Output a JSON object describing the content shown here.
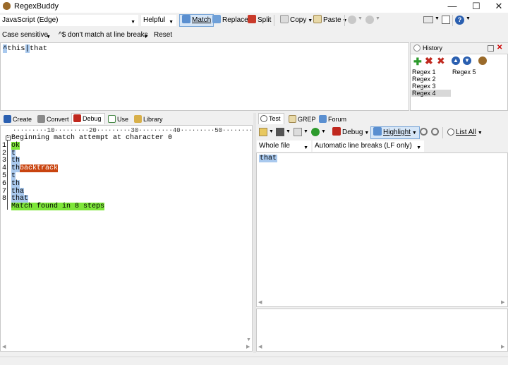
{
  "app": {
    "title": "RegexBuddy",
    "icon": "regexbuddy-icon"
  },
  "window_controls": {
    "minimize": "—",
    "maximize": "☐",
    "close": "✕"
  },
  "toolbar1": {
    "flavor": "JavaScript (Edge)",
    "helpful": "Helpful",
    "match": "Match",
    "replace": "Replace",
    "split": "Split",
    "copy": "Copy",
    "paste": "Paste"
  },
  "toolbar2": {
    "case": "Case sensitive",
    "caret": "^$ don't match at line breaks",
    "reset": "Reset"
  },
  "regex": {
    "caret": "^",
    "part1": "this",
    "pipe": "|",
    "part2": "that"
  },
  "history": {
    "title": "History",
    "items": [
      "Regex 1",
      "Regex 2",
      "Regex 3",
      "Regex 4",
      "Regex 5"
    ],
    "selected": "Regex 4"
  },
  "left_tabs": [
    "Create",
    "Convert",
    "Debug",
    "Use",
    "Library"
  ],
  "right_tabs": [
    "Test",
    "GREP",
    "Forum"
  ],
  "debug": {
    "ruler": "·········10·········20·········30·········40·········50········",
    "lines": [
      {
        "num": "",
        "pre": "",
        "text": "Beginning match attempt at character 0",
        "cls": ""
      },
      {
        "num": "1",
        "pre": "",
        "text": "ok",
        "cls": "g"
      },
      {
        "num": "2",
        "pre": "",
        "text": "t",
        "cls": "b"
      },
      {
        "num": "3",
        "pre": "",
        "text": "th",
        "cls": "b"
      },
      {
        "num": "4",
        "pre": "th",
        "text": "backtrack",
        "cls": "r"
      },
      {
        "num": "5",
        "pre": "",
        "text": "t",
        "cls": "b"
      },
      {
        "num": "6",
        "pre": "",
        "text": "th",
        "cls": "b"
      },
      {
        "num": "7",
        "pre": "",
        "text": "tha",
        "cls": "b"
      },
      {
        "num": "8",
        "pre": "",
        "text": "that",
        "cls": "b"
      },
      {
        "num": "",
        "pre": "",
        "text": "Match found in 8 steps",
        "cls": "g"
      }
    ]
  },
  "test_toolbar": {
    "debug": "Debug",
    "highlight": "Highlight",
    "list_all": "List All"
  },
  "test_options": {
    "scope": "Whole file",
    "line_breaks": "Automatic line breaks (LF only)"
  },
  "test": {
    "subject": "that"
  },
  "colors": {
    "match_green": "#7ee63a",
    "highlight_blue": "#a9c9ee",
    "backtrack": "#c9440f"
  }
}
